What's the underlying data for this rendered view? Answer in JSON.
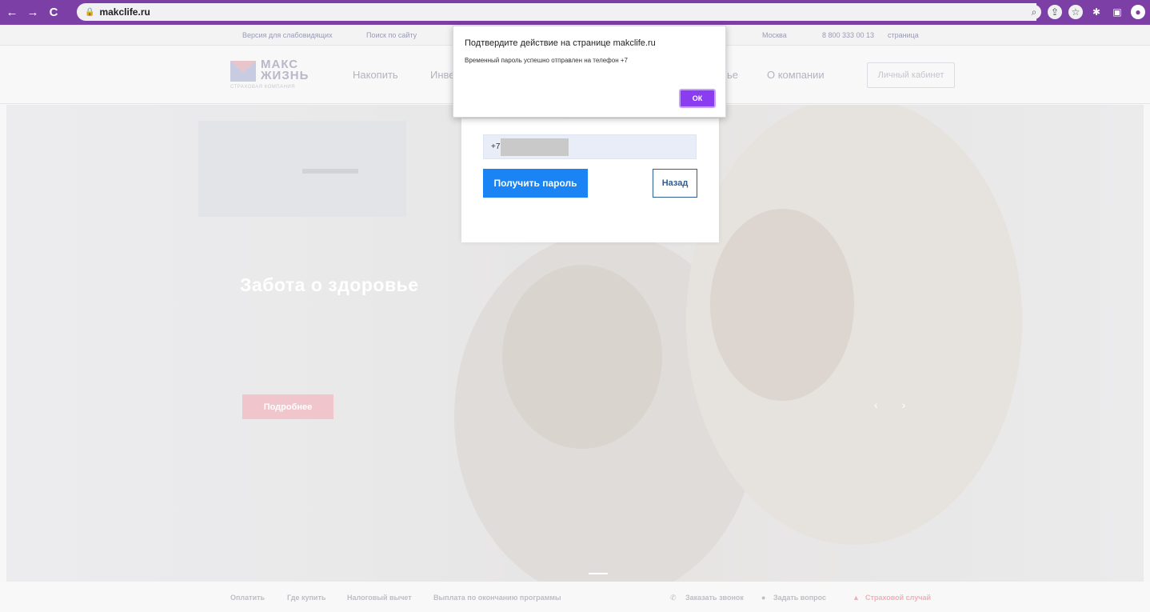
{
  "browser": {
    "url": "makclife.ru",
    "nav": {
      "back": "←",
      "forward": "→",
      "reload": "C"
    },
    "icons": [
      "zoom-icon",
      "share-icon",
      "star-icon",
      "extension-icon",
      "sidepanel-icon",
      "profile-icon"
    ]
  },
  "topline": {
    "accessible": "Версия для слабовидящих",
    "search": "Поиск по сайту",
    "city": "Москва",
    "phone": "8 800 333 00 13",
    "page": "страница"
  },
  "header": {
    "logo_line1": "МАКС",
    "logo_line2": "ЖИЗНЬ",
    "logo_sub": "СТРАХОВАЯ КОМПАНИЯ",
    "nav": [
      "Накопить",
      "Инве",
      "ье",
      "О компании"
    ],
    "cabinet": "Личный кабинет"
  },
  "hero": {
    "title": "Забота о здоровье",
    "button": "Подробнее",
    "prev": "‹",
    "next": "›"
  },
  "login": {
    "phone_prefix": "+7",
    "get_password": "Получить пароль",
    "back": "Назад"
  },
  "dialog": {
    "title": "Подтвердите действие на странице makclife.ru",
    "message": "Временный пароль успешно отправлен на телефон +7",
    "ok": "ОК"
  },
  "footer": {
    "links": [
      "Оплатить",
      "Где купить",
      "Налоговый вычет",
      "Выплата по окончанию программы"
    ],
    "actions": [
      "Заказать звонок",
      "Задать вопрос",
      "Страховой случай"
    ]
  },
  "colors": {
    "browser_accent": "#7b3fa5",
    "primary_button": "#1a84f4",
    "dialog_ok": "#8a3cf0"
  }
}
